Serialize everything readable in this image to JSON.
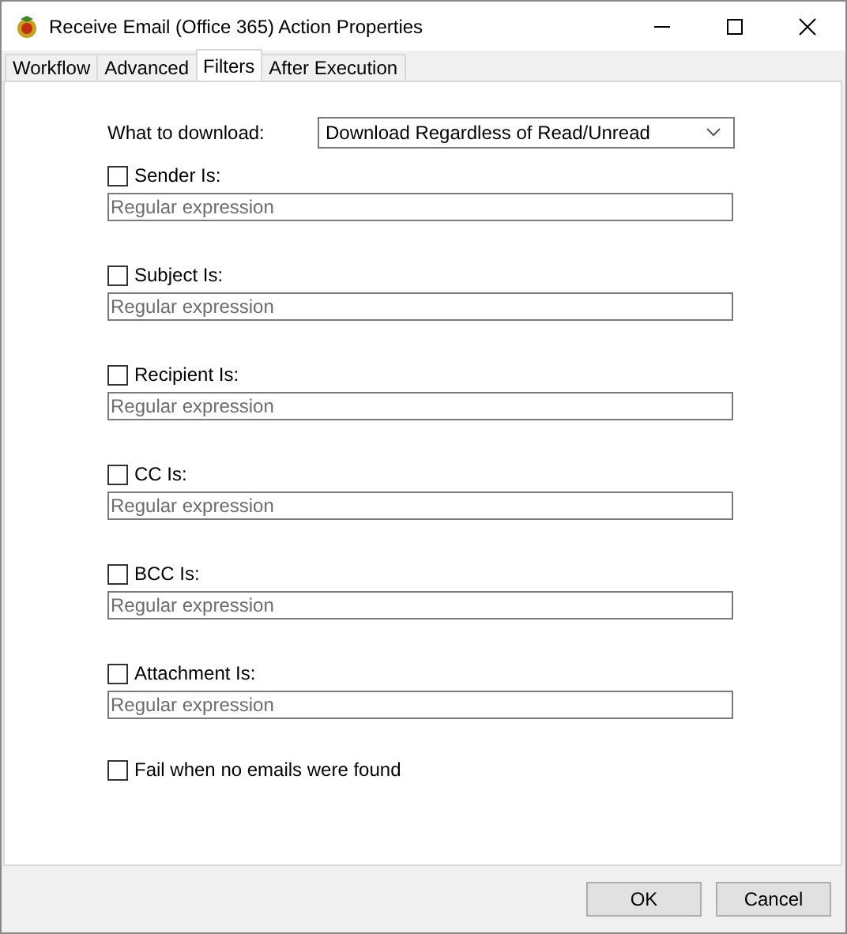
{
  "window": {
    "title": "Receive Email (Office 365) Action Properties"
  },
  "tabs": [
    {
      "label": "Workflow",
      "selected": false
    },
    {
      "label": "Advanced",
      "selected": false
    },
    {
      "label": "Filters",
      "selected": true
    },
    {
      "label": "After Execution",
      "selected": false
    }
  ],
  "download": {
    "label": "What to download:",
    "value": "Download Regardless of Read/Unread"
  },
  "filters": [
    {
      "label": "Sender Is:",
      "checked": false,
      "placeholder": "Regular expression"
    },
    {
      "label": "Subject Is:",
      "checked": false,
      "placeholder": "Regular expression"
    },
    {
      "label": "Recipient Is:",
      "checked": false,
      "placeholder": "Regular expression"
    },
    {
      "label": "CC Is:",
      "checked": false,
      "placeholder": "Regular expression"
    },
    {
      "label": "BCC Is:",
      "checked": false,
      "placeholder": "Regular expression"
    },
    {
      "label": "Attachment Is:",
      "checked": false,
      "placeholder": "Regular expression"
    }
  ],
  "fail_option": {
    "label": "Fail when no emails were found",
    "checked": false
  },
  "buttons": [
    {
      "label": "OK"
    },
    {
      "label": "Cancel"
    }
  ]
}
